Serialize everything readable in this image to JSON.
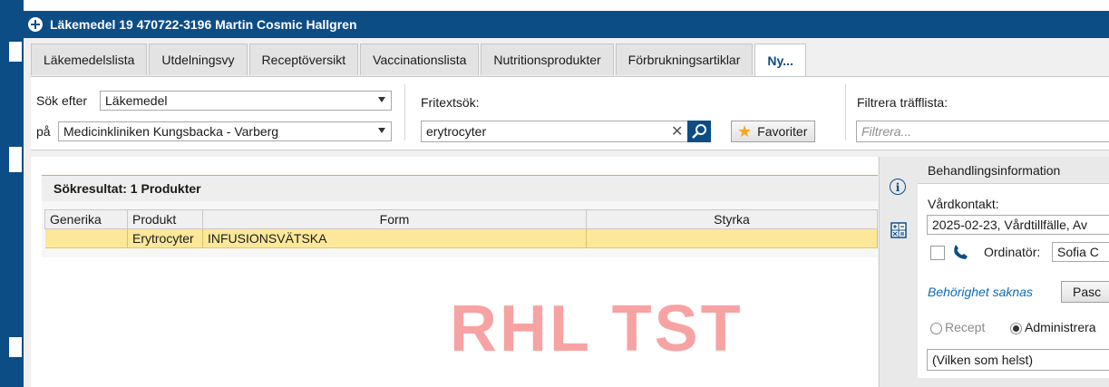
{
  "window": {
    "title": "Läkemedel 19 470722-3196 Martin Cosmic Hallgren"
  },
  "tabs": [
    {
      "label": "Läkemedelslista"
    },
    {
      "label": "Utdelningsvy"
    },
    {
      "label": "Receptöversikt"
    },
    {
      "label": "Vaccinationslista"
    },
    {
      "label": "Nutritionsprodukter"
    },
    {
      "label": "Förbrukningsartiklar"
    },
    {
      "label": "Ny...",
      "active": true
    }
  ],
  "search": {
    "search_for_label": "Sök efter",
    "search_for_value": "Läkemedel",
    "on_label": "på",
    "on_value": "Medicinkliniken Kungsbacka - Varberg",
    "freetext_label": "Fritextsök:",
    "freetext_value": "erytrocyter",
    "clear_symbol": "✕",
    "favorites_label": "Favoriter",
    "filter_label": "Filtrera träfflista:",
    "filter_placeholder": "Filtrera..."
  },
  "results": {
    "header": "Sökresultat: 1 Produkter",
    "columns": [
      "Generika",
      "Produkt",
      "Form",
      "Styrka"
    ],
    "rows": [
      {
        "generika": "",
        "produkt": "Erytrocyter",
        "form": "INFUSIONSVÄTSKA",
        "styrka": ""
      }
    ]
  },
  "watermark": "RHL TST",
  "side_panel": {
    "title": "Behandlingsinformation",
    "vardkontakt_label": "Vårdkontakt:",
    "vardkontakt_value": "2025-02-23, Vårdtillfälle, Av",
    "ordinator_label": "Ordinatör:",
    "ordinator_value": "Sofia C",
    "permission_link": "Behörighet saknas",
    "pascal_button": "Pasc",
    "radio_recept": "Recept",
    "radio_admin": "Administrera",
    "selected_radio": "Administrera",
    "any_select": "(Vilken som helst)"
  },
  "colors": {
    "primary": "#0d4d86",
    "selected_row": "#fde89a",
    "watermark": "#f7a3a3"
  }
}
